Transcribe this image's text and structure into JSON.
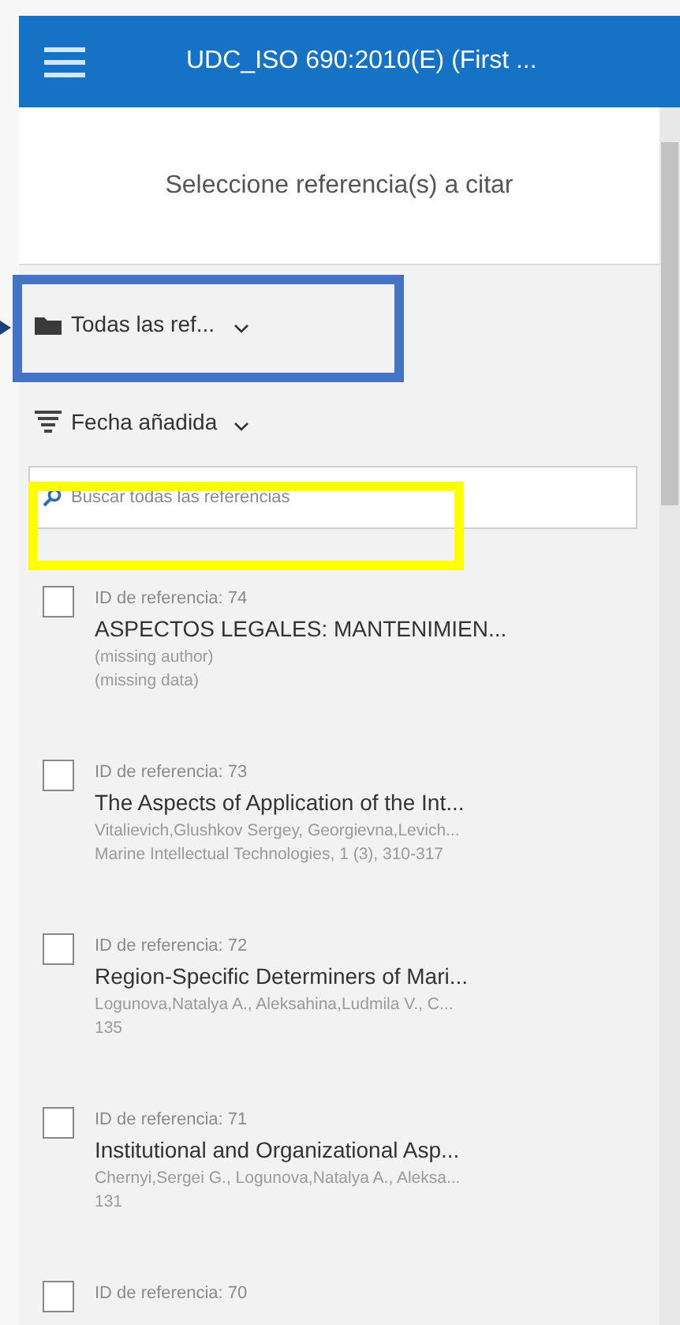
{
  "header": {
    "title": "UDC_ISO 690:2010(E) (First ..."
  },
  "prompt": "Seleccione referencia(s) a citar",
  "folder_filter": {
    "label": "Todas las ref..."
  },
  "sort": {
    "label": "Fecha añadida"
  },
  "search": {
    "placeholder": "Buscar todas las referencias"
  },
  "references": [
    {
      "id_label": "ID de referencia: 74",
      "title": "ASPECTOS LEGALES: MANTENIMIEN...",
      "authors": "(missing author)",
      "source": "(missing data)",
      "checked": false
    },
    {
      "id_label": "ID de referencia: 73",
      "title": "The Aspects of Application of the Int...",
      "authors": "Vitalievich,Glushkov Sergey, Georgievna,Levich...",
      "source": "Marine Intellectual Technologies, 1 (3), 310-317",
      "checked": false
    },
    {
      "id_label": "ID de referencia: 72",
      "title": "Region-Specific Determiners of Mari...",
      "authors": "Logunova,Natalya A., Aleksahina,Ludmila V., C...",
      "source": "135",
      "checked": false
    },
    {
      "id_label": "ID de referencia: 71",
      "title": "Institutional and Organizational Asp...",
      "authors": "Chernyi,Sergei G., Logunova,Natalya A., Aleksa...",
      "source": "131",
      "checked": false
    },
    {
      "id_label": "ID de referencia: 70",
      "checked": false
    }
  ]
}
